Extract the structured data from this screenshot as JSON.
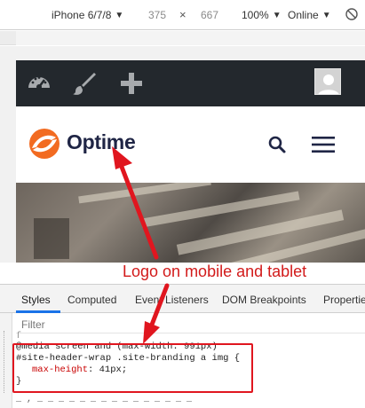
{
  "device_toolbar": {
    "device": "iPhone 6/7/8",
    "width": "375",
    "times": "×",
    "height": "667",
    "zoom": "100%",
    "network": "Online"
  },
  "site": {
    "logo_text": "Optime",
    "admin_icons": [
      "dashboard-icon",
      "brush-icon",
      "plus-icon"
    ]
  },
  "annotation": {
    "label": "Logo on mobile and tablet"
  },
  "devtools": {
    "tabs": [
      "Styles",
      "Computed",
      "Event Listeners",
      "DOM Breakpoints",
      "Properties"
    ],
    "active_tab": "Styles",
    "filter_placeholder": "Filter",
    "css": {
      "media": "@media screen and (max-width: 991px)",
      "selector": "#site-header-wrap .site-branding a img {",
      "property": "max-height",
      "value": "41px;",
      "close": "}"
    }
  },
  "colors": {
    "annotation_red": "#e0161f",
    "logo_orange": "#f26b21",
    "logo_navy": "#1f2545",
    "admin_bar": "#23282d"
  }
}
